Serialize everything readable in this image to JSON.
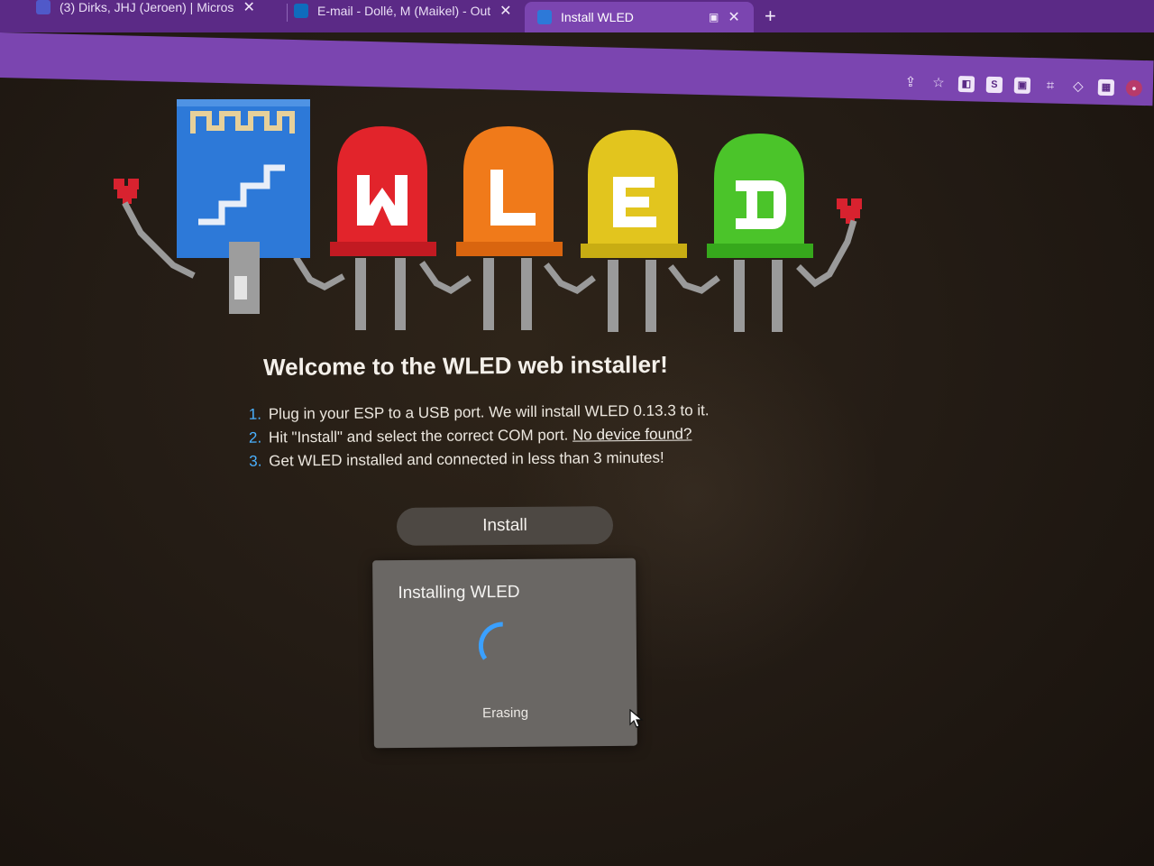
{
  "browser": {
    "tabs": [
      {
        "title": "(3) Dirks, JHJ (Jeroen) | Micros",
        "favicon": "teams-icon",
        "active": false
      },
      {
        "title": "E-mail - Dollé, M (Maikel) - Out",
        "favicon": "outlook-icon",
        "active": false
      },
      {
        "title": "Install WLED",
        "favicon": "wled-icon",
        "active": true
      }
    ],
    "new_tab_glyph": "+",
    "close_glyph": "✕",
    "toolbar_icons": [
      "share-icon",
      "bookmark-star-icon",
      "extension-icon",
      "extension-s-icon",
      "extension-window-icon",
      "extension-crop-icon",
      "extension-shield-icon",
      "extension-image-icon",
      "profile-avatar-icon"
    ]
  },
  "installer": {
    "logo_text": "WLED",
    "welcome": "Welcome to the WLED web installer!",
    "steps": [
      {
        "num": "1.",
        "text": "Plug in your ESP to a USB port. We will install WLED 0.13.3 to it."
      },
      {
        "num": "2.",
        "text": "Hit \"Install\" and select the correct COM port. ",
        "link": "No device found?"
      },
      {
        "num": "3.",
        "text": "Get WLED installed and connected in less than 3 minutes!"
      }
    ],
    "install_label": "Install"
  },
  "dialog": {
    "title": "Installing WLED",
    "status": "Erasing"
  },
  "colors": {
    "browser_purple": "#7b45b0",
    "accent_blue": "#4ab1ff",
    "led_red": "#e2242b",
    "led_orange": "#f07a1a",
    "led_yellow": "#e2c51e",
    "led_green": "#4bc42a",
    "board_blue": "#2d79d8"
  }
}
